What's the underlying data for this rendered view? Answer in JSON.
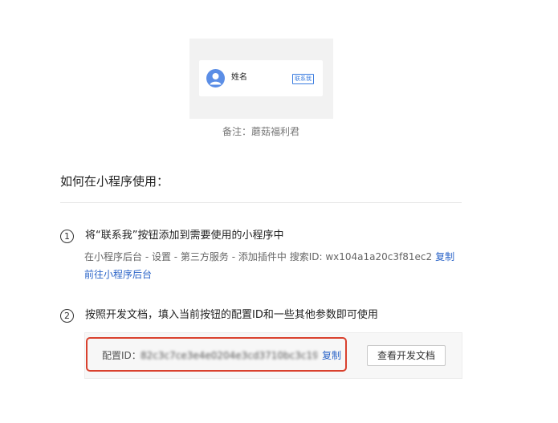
{
  "preview": {
    "card_name": "姓名",
    "badge_label": "联系我",
    "avatar_icon": "user-avatar-icon",
    "remark": "备注：蘑菇福利君"
  },
  "section_title": "如何在小程序使用：",
  "steps": [
    {
      "number": "1",
      "title": "将“联系我”按钮添加到需要使用的小程序中",
      "desc": "在小程序后台 - 设置 - 第三方服务 - 添加插件中 搜索ID: wx104a1a20c3f81ec2",
      "copy_label": "复制",
      "link_label": "前往小程序后台"
    },
    {
      "number": "2",
      "title": "按照开发文档，填入当前按钮的配置ID和一些其他参数即可使用",
      "config_label": "配置ID：",
      "config_id": "82c3c7ce3e4e0204e3cd3710bc3c1909",
      "copy_label": "复制",
      "doc_button": "查看开发文档"
    }
  ],
  "colors": {
    "link": "#2b64c8",
    "avatar": "#5b8ee6",
    "highlight": "#d9412e"
  }
}
